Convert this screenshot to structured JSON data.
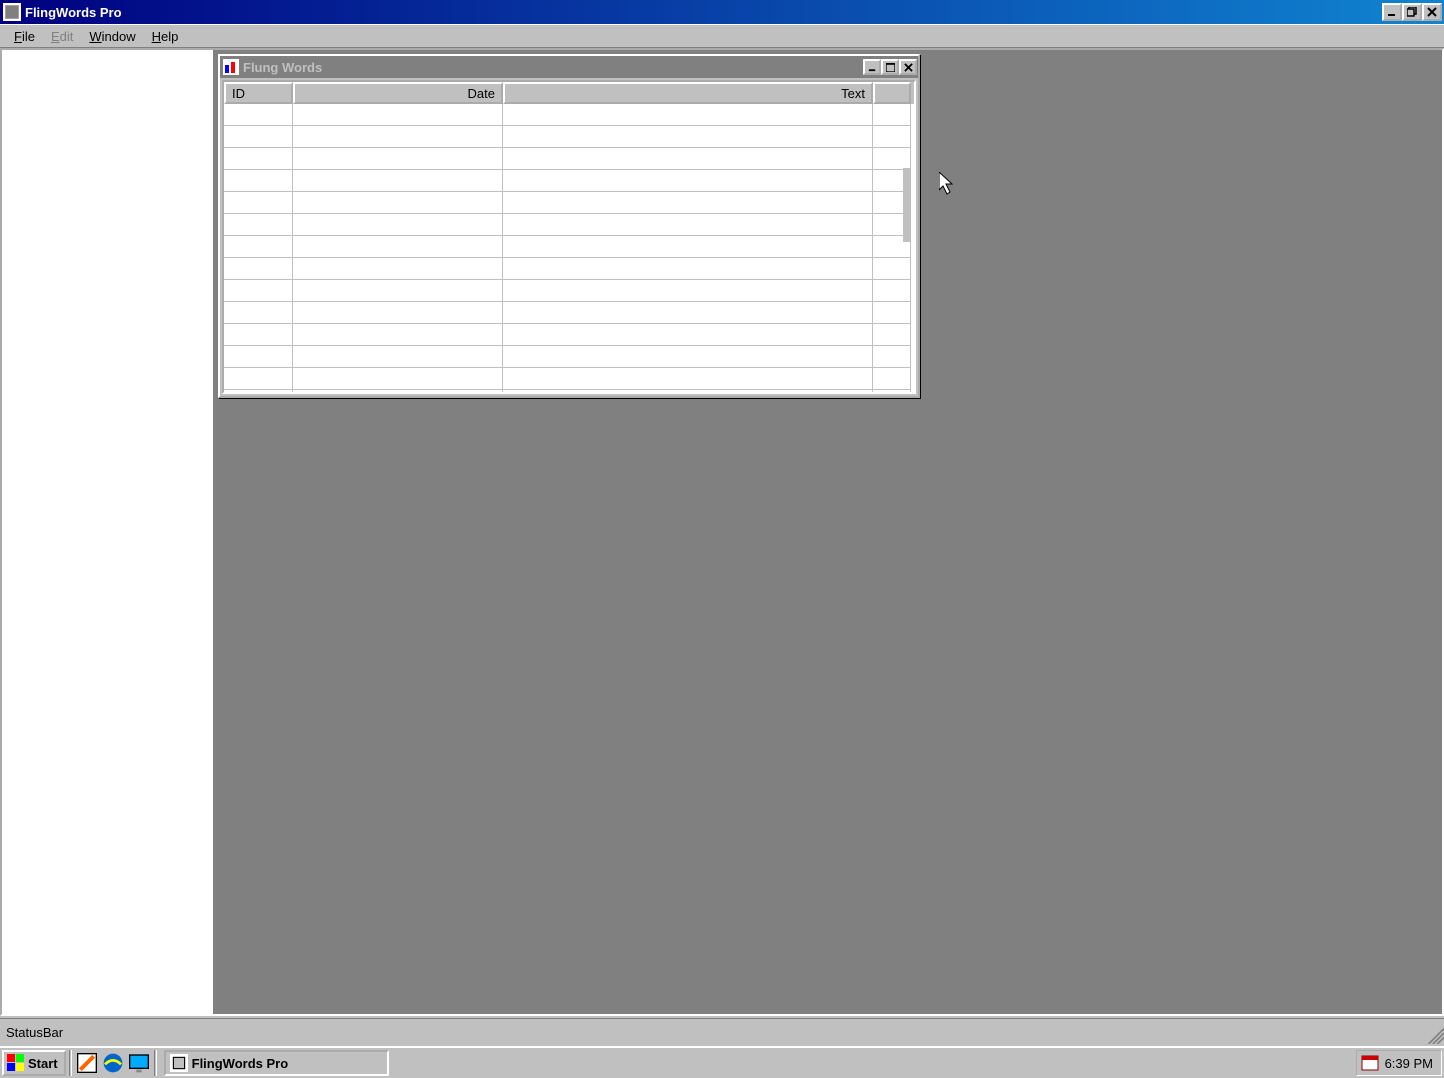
{
  "app": {
    "title": "FlingWords Pro",
    "icon": "app-icon"
  },
  "menubar": {
    "file": "File",
    "edit": "Edit",
    "window": "Window",
    "help": "Help"
  },
  "child_window": {
    "title": "Flung Words",
    "columns": {
      "id": "ID",
      "date": "Date",
      "text": "Text"
    },
    "rows": []
  },
  "statusbar": {
    "text": "StatusBar"
  },
  "taskbar": {
    "start": "Start",
    "task_button": "FlingWords Pro",
    "clock": "6:39 PM",
    "quick_launch": [
      "notepad-icon",
      "ie-icon",
      "desktop-icon"
    ]
  }
}
